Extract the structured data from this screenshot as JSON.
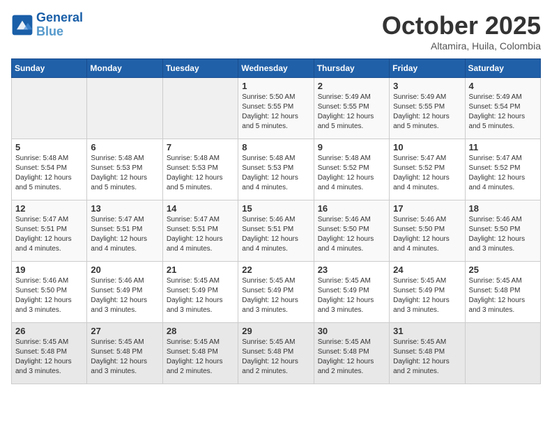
{
  "header": {
    "logo_line1": "General",
    "logo_line2": "Blue",
    "month": "October 2025",
    "location": "Altamira, Huila, Colombia"
  },
  "days_of_week": [
    "Sunday",
    "Monday",
    "Tuesday",
    "Wednesday",
    "Thursday",
    "Friday",
    "Saturday"
  ],
  "weeks": [
    [
      {
        "day": "",
        "info": ""
      },
      {
        "day": "",
        "info": ""
      },
      {
        "day": "",
        "info": ""
      },
      {
        "day": "1",
        "info": "Sunrise: 5:50 AM\nSunset: 5:55 PM\nDaylight: 12 hours\nand 5 minutes."
      },
      {
        "day": "2",
        "info": "Sunrise: 5:49 AM\nSunset: 5:55 PM\nDaylight: 12 hours\nand 5 minutes."
      },
      {
        "day": "3",
        "info": "Sunrise: 5:49 AM\nSunset: 5:55 PM\nDaylight: 12 hours\nand 5 minutes."
      },
      {
        "day": "4",
        "info": "Sunrise: 5:49 AM\nSunset: 5:54 PM\nDaylight: 12 hours\nand 5 minutes."
      }
    ],
    [
      {
        "day": "5",
        "info": "Sunrise: 5:48 AM\nSunset: 5:54 PM\nDaylight: 12 hours\nand 5 minutes."
      },
      {
        "day": "6",
        "info": "Sunrise: 5:48 AM\nSunset: 5:53 PM\nDaylight: 12 hours\nand 5 minutes."
      },
      {
        "day": "7",
        "info": "Sunrise: 5:48 AM\nSunset: 5:53 PM\nDaylight: 12 hours\nand 5 minutes."
      },
      {
        "day": "8",
        "info": "Sunrise: 5:48 AM\nSunset: 5:53 PM\nDaylight: 12 hours\nand 4 minutes."
      },
      {
        "day": "9",
        "info": "Sunrise: 5:48 AM\nSunset: 5:52 PM\nDaylight: 12 hours\nand 4 minutes."
      },
      {
        "day": "10",
        "info": "Sunrise: 5:47 AM\nSunset: 5:52 PM\nDaylight: 12 hours\nand 4 minutes."
      },
      {
        "day": "11",
        "info": "Sunrise: 5:47 AM\nSunset: 5:52 PM\nDaylight: 12 hours\nand 4 minutes."
      }
    ],
    [
      {
        "day": "12",
        "info": "Sunrise: 5:47 AM\nSunset: 5:51 PM\nDaylight: 12 hours\nand 4 minutes."
      },
      {
        "day": "13",
        "info": "Sunrise: 5:47 AM\nSunset: 5:51 PM\nDaylight: 12 hours\nand 4 minutes."
      },
      {
        "day": "14",
        "info": "Sunrise: 5:47 AM\nSunset: 5:51 PM\nDaylight: 12 hours\nand 4 minutes."
      },
      {
        "day": "15",
        "info": "Sunrise: 5:46 AM\nSunset: 5:51 PM\nDaylight: 12 hours\nand 4 minutes."
      },
      {
        "day": "16",
        "info": "Sunrise: 5:46 AM\nSunset: 5:50 PM\nDaylight: 12 hours\nand 4 minutes."
      },
      {
        "day": "17",
        "info": "Sunrise: 5:46 AM\nSunset: 5:50 PM\nDaylight: 12 hours\nand 4 minutes."
      },
      {
        "day": "18",
        "info": "Sunrise: 5:46 AM\nSunset: 5:50 PM\nDaylight: 12 hours\nand 3 minutes."
      }
    ],
    [
      {
        "day": "19",
        "info": "Sunrise: 5:46 AM\nSunset: 5:50 PM\nDaylight: 12 hours\nand 3 minutes."
      },
      {
        "day": "20",
        "info": "Sunrise: 5:46 AM\nSunset: 5:49 PM\nDaylight: 12 hours\nand 3 minutes."
      },
      {
        "day": "21",
        "info": "Sunrise: 5:45 AM\nSunset: 5:49 PM\nDaylight: 12 hours\nand 3 minutes."
      },
      {
        "day": "22",
        "info": "Sunrise: 5:45 AM\nSunset: 5:49 PM\nDaylight: 12 hours\nand 3 minutes."
      },
      {
        "day": "23",
        "info": "Sunrise: 5:45 AM\nSunset: 5:49 PM\nDaylight: 12 hours\nand 3 minutes."
      },
      {
        "day": "24",
        "info": "Sunrise: 5:45 AM\nSunset: 5:49 PM\nDaylight: 12 hours\nand 3 minutes."
      },
      {
        "day": "25",
        "info": "Sunrise: 5:45 AM\nSunset: 5:48 PM\nDaylight: 12 hours\nand 3 minutes."
      }
    ],
    [
      {
        "day": "26",
        "info": "Sunrise: 5:45 AM\nSunset: 5:48 PM\nDaylight: 12 hours\nand 3 minutes."
      },
      {
        "day": "27",
        "info": "Sunrise: 5:45 AM\nSunset: 5:48 PM\nDaylight: 12 hours\nand 3 minutes."
      },
      {
        "day": "28",
        "info": "Sunrise: 5:45 AM\nSunset: 5:48 PM\nDaylight: 12 hours\nand 2 minutes."
      },
      {
        "day": "29",
        "info": "Sunrise: 5:45 AM\nSunset: 5:48 PM\nDaylight: 12 hours\nand 2 minutes."
      },
      {
        "day": "30",
        "info": "Sunrise: 5:45 AM\nSunset: 5:48 PM\nDaylight: 12 hours\nand 2 minutes."
      },
      {
        "day": "31",
        "info": "Sunrise: 5:45 AM\nSunset: 5:48 PM\nDaylight: 12 hours\nand 2 minutes."
      },
      {
        "day": "",
        "info": ""
      }
    ]
  ]
}
